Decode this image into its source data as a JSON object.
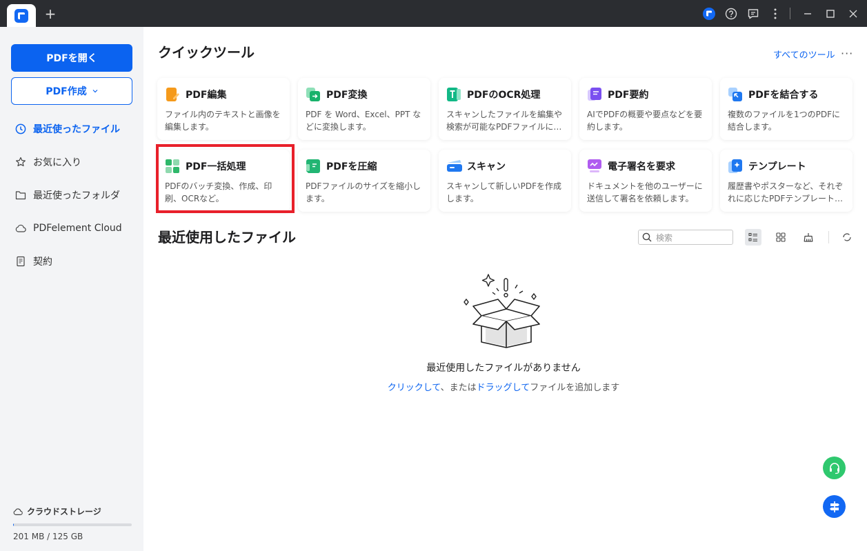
{
  "titlebar": {
    "new_tab": "+",
    "icons": [
      "app-badge-icon",
      "help-icon",
      "feedback-icon",
      "more-vertical-icon",
      "minimize-icon",
      "maximize-icon",
      "close-icon"
    ]
  },
  "sidebar": {
    "open_pdf": "PDFを開く",
    "create_pdf": "PDF作成",
    "nav": [
      {
        "label": "最近使ったファイル",
        "active": true
      },
      {
        "label": "お気に入り"
      },
      {
        "label": "最近使ったフォルダ"
      },
      {
        "label": "PDFelement Cloud"
      },
      {
        "label": "契約"
      }
    ],
    "storage_label": "クラウドストレージ",
    "storage_text": "201 MB / 125 GB"
  },
  "quick_tools": {
    "title": "クイックツール",
    "all_tools": "すべてのツール",
    "cards": [
      {
        "title": "PDF編集",
        "desc": "ファイル内のテキストと画像を編集します。"
      },
      {
        "title": "PDF変換",
        "desc": "PDF を Word、Excel、PPT などに変換します。"
      },
      {
        "title": "PDFのOCR処理",
        "desc": "スキャンしたファイルを編集や検索が可能なPDFファイルに…"
      },
      {
        "title": "PDF要約",
        "desc": "AIでPDFの概要や要点などを要約します。"
      },
      {
        "title": "PDFを結合する",
        "desc": "複数のファイルを1つのPDFに結合します。"
      },
      {
        "title": "PDF一括処理",
        "desc": "PDFのバッチ変換、作成、印刷、OCRなど。"
      },
      {
        "title": "PDFを圧縮",
        "desc": "PDFファイルのサイズを縮小します。"
      },
      {
        "title": "スキャン",
        "desc": "スキャンして新しいPDFを作成します。"
      },
      {
        "title": "電子署名を要求",
        "desc": "ドキュメントを他のユーザーに送信して署名を依頼します。"
      },
      {
        "title": "テンプレート",
        "desc": "履歴書やポスターなど、それぞれに応じたPDFテンプレート…"
      }
    ]
  },
  "recent": {
    "title": "最近使用したファイル",
    "search_placeholder": "検索",
    "empty_title": "最近使用したファイルがありません",
    "empty_click": "クリックして",
    "empty_or": "、または",
    "empty_drag": "ドラッグして",
    "empty_add": "ファイルを追加します"
  },
  "colors": {
    "accent": "#0b63f0",
    "highlight": "#e8202a",
    "sidebar_bg": "#f3f4f6",
    "titlebar_bg": "#2b2d31"
  }
}
